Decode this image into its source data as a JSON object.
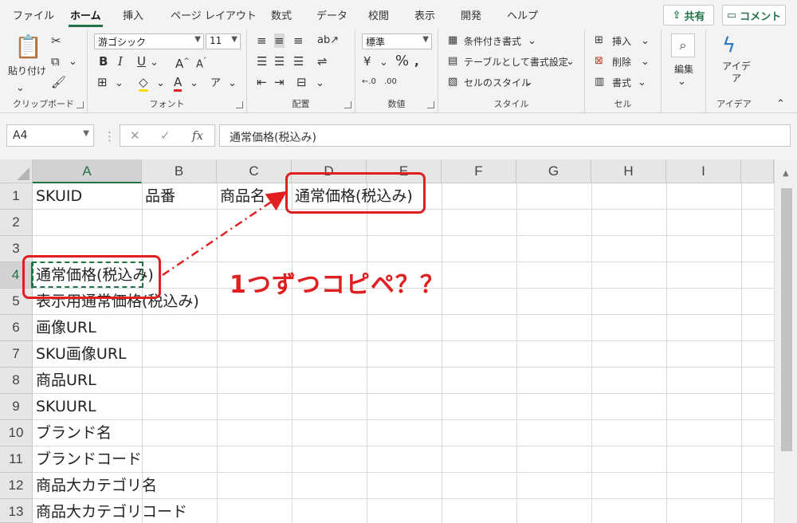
{
  "menu": {
    "tabs": [
      "ファイル",
      "ホーム",
      "挿入",
      "ページ レイアウト",
      "数式",
      "データ",
      "校閲",
      "表示",
      "開発",
      "ヘルプ"
    ],
    "active_tab": "ホーム",
    "share_label": "共有",
    "comment_label": "コメント"
  },
  "ribbon": {
    "clipboard": {
      "label": "クリップボード",
      "paste": "貼り付け"
    },
    "font": {
      "label": "フォント",
      "font_name": "游ゴシック",
      "font_size": "11"
    },
    "alignment": {
      "label": "配置"
    },
    "number": {
      "label": "数値",
      "format": "標準"
    },
    "styles": {
      "label": "スタイル",
      "conditional": "条件付き書式",
      "as_table": "テーブルとして書式設定",
      "cell_styles": "セルのスタイル"
    },
    "cells": {
      "label": "セル",
      "insert": "挿入",
      "delete": "削除",
      "format": "書式"
    },
    "editing": {
      "label": "編集"
    },
    "ideas": {
      "label": "アイデア",
      "button": "アイデア"
    }
  },
  "formula_bar": {
    "name_box": "A4",
    "formula": "通常価格(税込み)"
  },
  "grid": {
    "columns": [
      "A",
      "B",
      "C",
      "D",
      "E",
      "F",
      "G",
      "H",
      "I"
    ],
    "selected_column": "A",
    "rows": [
      "1",
      "2",
      "3",
      "4",
      "5",
      "6",
      "7",
      "8",
      "9",
      "10",
      "11",
      "12",
      "13"
    ],
    "selected_row": "4",
    "row1": {
      "A": "SKUID",
      "B": "品番",
      "C": "商品名",
      "D": "通常価格(税込み)"
    },
    "columnA": {
      "r4": "通常価格(税込み)",
      "r5": "表示用通常価格(税込み)",
      "r6": "画像URL",
      "r7": "SKU画像URL",
      "r8": "商品URL",
      "r9": "SKUURL",
      "r10": "ブランド名",
      "r11": "ブランドコード",
      "r12": "商品大カテゴリ名",
      "r13": "商品大カテゴリコード"
    }
  },
  "annotation": {
    "text": "1つずつコピペ？？",
    "color": "#e02020"
  },
  "colors": {
    "accent": "#217346"
  }
}
